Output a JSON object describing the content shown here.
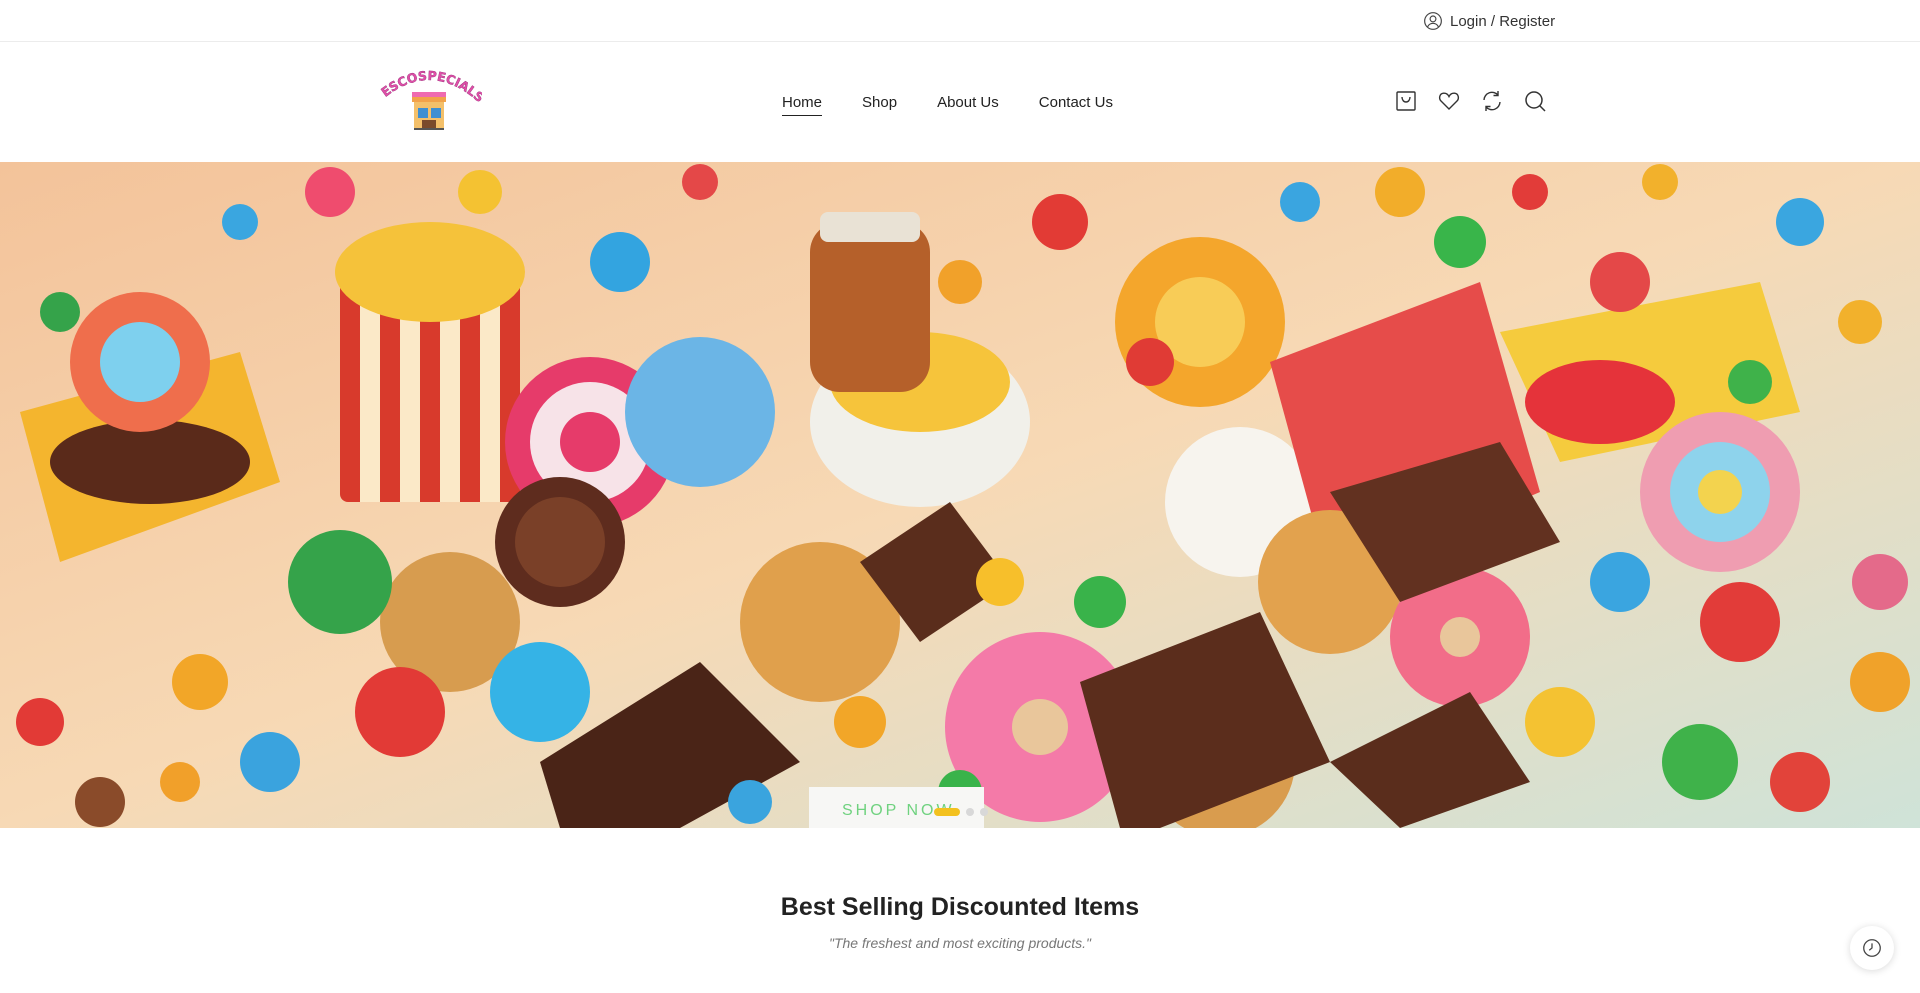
{
  "topbar": {
    "login_label": "Login / Register"
  },
  "header": {
    "logo_text": "TESCOSPECIALS",
    "nav": [
      {
        "label": "Home",
        "active": true
      },
      {
        "label": "Shop",
        "active": false
      },
      {
        "label": "About Us",
        "active": false
      },
      {
        "label": "Contact Us",
        "active": false
      }
    ],
    "icons": [
      "cart-icon",
      "heart-icon",
      "compare-icon",
      "search-icon"
    ]
  },
  "hero": {
    "image_subject": "candy, chocolate, cookies and snacks",
    "button_label": "SHOP NOW",
    "slides": 3,
    "active_slide": 1,
    "colors": {
      "button_text": "#6fd27f",
      "active_dot": "#f3c11e"
    }
  },
  "section": {
    "title": "Best Selling Discounted Items",
    "subtitle": "\"The freshest and most exciting products.\""
  },
  "floating": {
    "icon": "history-icon"
  }
}
